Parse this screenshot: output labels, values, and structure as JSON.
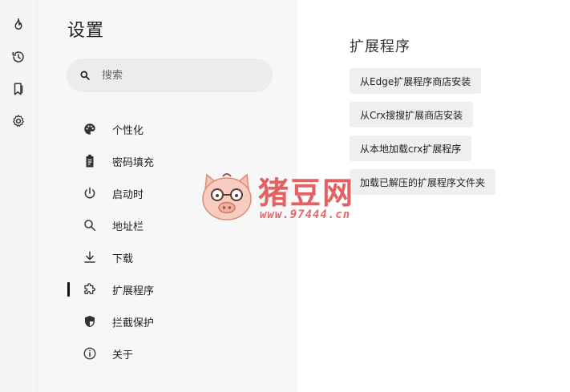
{
  "rail": {
    "items": [
      {
        "icon": "flame-icon"
      },
      {
        "icon": "history-icon"
      },
      {
        "icon": "bookmark-icon"
      },
      {
        "icon": "gear-icon"
      }
    ]
  },
  "nav": {
    "title": "设置",
    "search_placeholder": "搜索",
    "items": [
      {
        "label": "个性化",
        "icon": "palette-icon"
      },
      {
        "label": "密码填充",
        "icon": "clipboard-icon"
      },
      {
        "label": "启动时",
        "icon": "power-icon"
      },
      {
        "label": "地址栏",
        "icon": "search-icon"
      },
      {
        "label": "下载",
        "icon": "download-icon"
      },
      {
        "label": "扩展程序",
        "icon": "puzzle-icon",
        "active": true
      },
      {
        "label": "拦截保护",
        "icon": "shield-icon"
      },
      {
        "label": "关于",
        "icon": "info-icon"
      }
    ]
  },
  "main": {
    "title": "扩展程序",
    "buttons": [
      "从Edge扩展程序商店安装",
      "从Crx搜搜扩展商店安装",
      "从本地加载crx扩展程序",
      "加载已解压的扩展程序文件夹"
    ]
  },
  "watermark": {
    "brand": "猪豆网",
    "url": "www.97444.cn",
    "color": "#e25454"
  },
  "colors": {
    "rail_bg": "#f5f5f5",
    "nav_bg": "#f7f7f7",
    "search_bg": "#ececec",
    "button_bg": "#efefef",
    "active_indicator": "#111111"
  }
}
